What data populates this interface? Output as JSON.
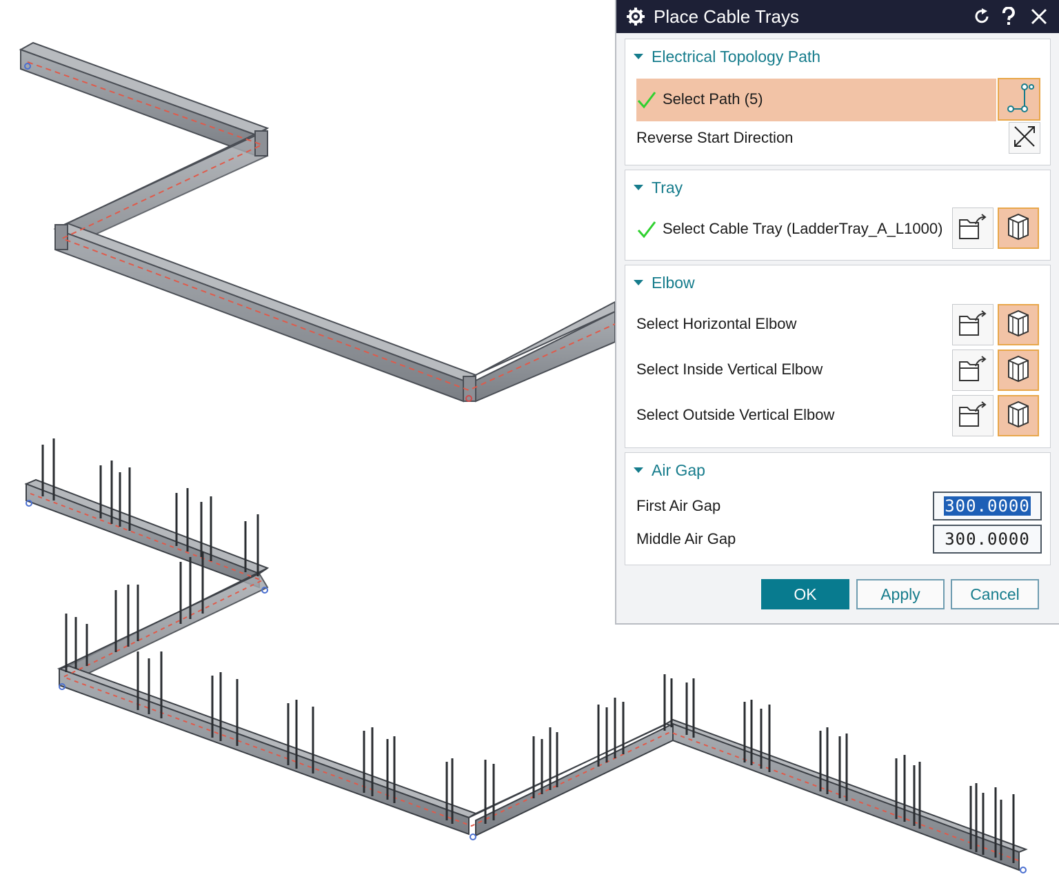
{
  "dialog": {
    "title": "Place Cable Trays",
    "title_icon": "gear-icon",
    "header_buttons": [
      "reset-icon",
      "help-icon",
      "close-icon"
    ]
  },
  "sections": {
    "topology": {
      "title": "Electrical Topology Path",
      "select_path_label": "Select Path (5)",
      "reverse_label": "Reverse Start Direction"
    },
    "tray": {
      "title": "Tray",
      "select_tray_label": "Select Cable Tray (LadderTray_A_L1000)"
    },
    "elbow": {
      "title": "Elbow",
      "horizontal_label": "Select Horizontal Elbow",
      "inside_vertical_label": "Select Inside Vertical Elbow",
      "outside_vertical_label": "Select Outside Vertical Elbow"
    },
    "air_gap": {
      "title": "Air Gap",
      "first_label": "First Air Gap",
      "first_value": "300.0000",
      "middle_label": "Middle Air Gap",
      "middle_value": "300.0000"
    }
  },
  "buttons": {
    "ok": "OK",
    "apply": "Apply",
    "cancel": "Cancel"
  },
  "colors": {
    "title_bar": "#1d2036",
    "accent": "#167c8c",
    "selection_highlight": "#f2c3a6",
    "check": "#2fd12f",
    "tray_fill": "#8a8e93",
    "centerline": "#e05a4a"
  }
}
